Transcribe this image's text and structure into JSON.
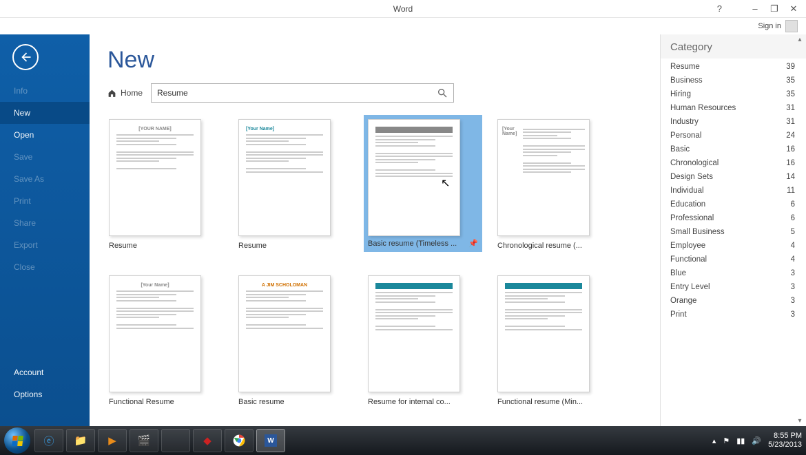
{
  "title": "Word",
  "signin": "Sign in",
  "sidebar": {
    "items": [
      {
        "label": "Info",
        "disabled": true
      },
      {
        "label": "New",
        "selected": true
      },
      {
        "label": "Open"
      },
      {
        "label": "Save",
        "disabled": true
      },
      {
        "label": "Save As",
        "disabled": true
      },
      {
        "label": "Print",
        "disabled": true
      },
      {
        "label": "Share",
        "disabled": true
      },
      {
        "label": "Export",
        "disabled": true
      },
      {
        "label": "Close",
        "disabled": true
      }
    ],
    "bottom": [
      {
        "label": "Account"
      },
      {
        "label": "Options"
      }
    ]
  },
  "page_title": "New",
  "home": "Home",
  "search_value": "Resume",
  "templates": [
    {
      "name": "Resume"
    },
    {
      "name": "Resume"
    },
    {
      "name": "Basic resume (Timeless ...",
      "selected": true
    },
    {
      "name": "Chronological resume (..."
    },
    {
      "name": "Functional Resume"
    },
    {
      "name": "Basic resume"
    },
    {
      "name": "Resume for internal co..."
    },
    {
      "name": "Functional resume (Min..."
    }
  ],
  "category_header": "Category",
  "categories": [
    {
      "name": "Resume",
      "count": 39
    },
    {
      "name": "Business",
      "count": 35
    },
    {
      "name": "Hiring",
      "count": 35
    },
    {
      "name": "Human Resources",
      "count": 31
    },
    {
      "name": "Industry",
      "count": 31
    },
    {
      "name": "Personal",
      "count": 24
    },
    {
      "name": "Basic",
      "count": 16
    },
    {
      "name": "Chronological",
      "count": 16
    },
    {
      "name": "Design Sets",
      "count": 14
    },
    {
      "name": "Individual",
      "count": 11
    },
    {
      "name": "Education",
      "count": 6
    },
    {
      "name": "Professional",
      "count": 6
    },
    {
      "name": "Small Business",
      "count": 5
    },
    {
      "name": "Employee",
      "count": 4
    },
    {
      "name": "Functional",
      "count": 4
    },
    {
      "name": "Blue",
      "count": 3
    },
    {
      "name": "Entry Level",
      "count": 3
    },
    {
      "name": "Orange",
      "count": 3
    },
    {
      "name": "Print",
      "count": 3
    }
  ],
  "taskbar": {
    "items": [
      "start",
      "ie",
      "explorer",
      "wmp",
      "video",
      "apps",
      "adobe",
      "chrome",
      "word"
    ],
    "time": "8:55 PM",
    "date": "5/23/2013"
  }
}
